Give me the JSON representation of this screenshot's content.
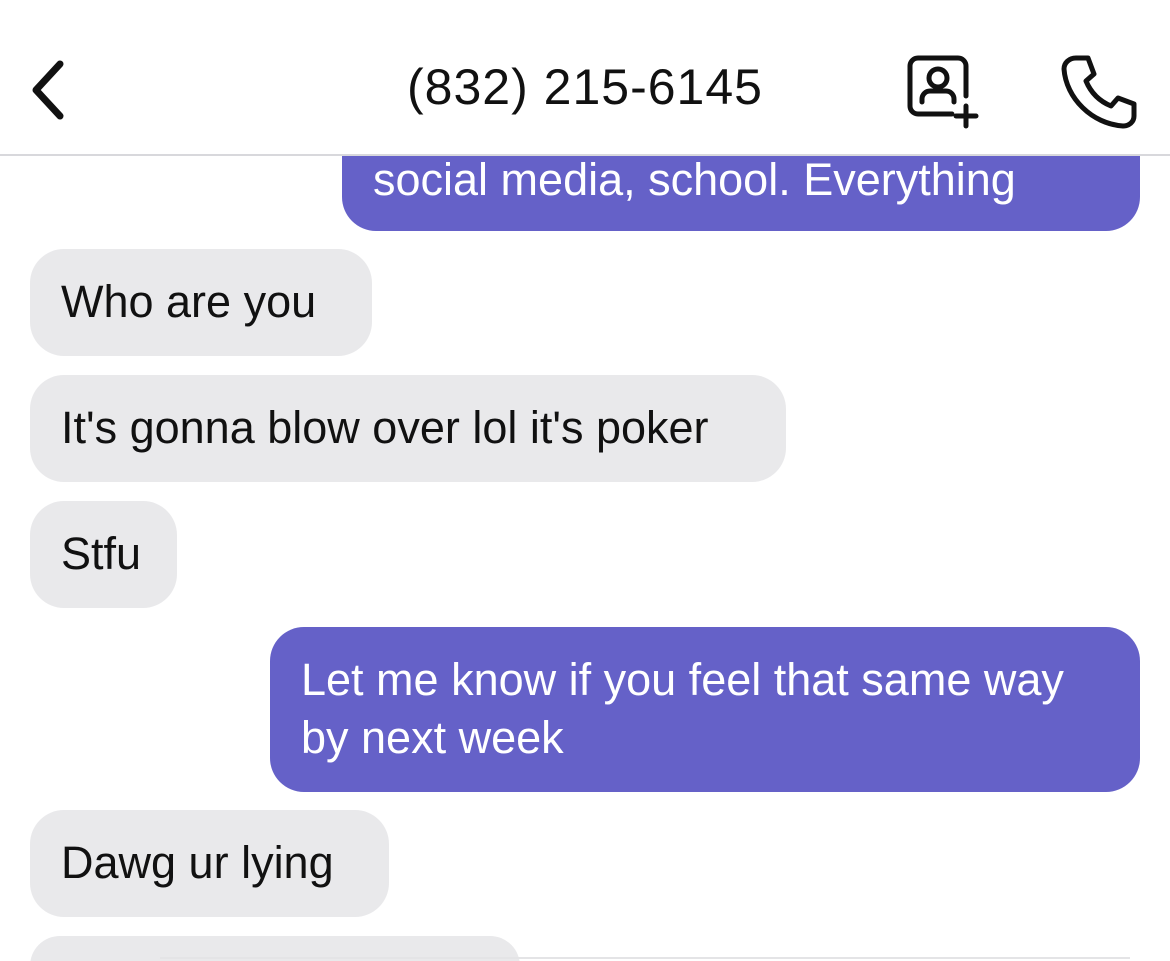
{
  "header": {
    "title": "(832) 215-6145",
    "back_icon": "chevron-left-icon",
    "contact_icon": "add-contact-icon",
    "call_icon": "phone-icon"
  },
  "messages": [
    {
      "direction": "outgoing",
      "text": "social media, school.  Everything"
    },
    {
      "direction": "incoming",
      "text": "Who are you"
    },
    {
      "direction": "incoming",
      "text": "It's gonna blow over lol it's poker"
    },
    {
      "direction": "incoming",
      "text": "Stfu"
    },
    {
      "direction": "outgoing",
      "lines": [
        "Let me know if you feel that same way",
        "by next week"
      ]
    },
    {
      "direction": "incoming",
      "text": "Dawg ur lying"
    }
  ],
  "colors": {
    "outgoing_bubble": "#6561c8",
    "incoming_bubble": "#e9e9eb",
    "outgoing_text": "#ffffff",
    "incoming_text": "#111111"
  }
}
